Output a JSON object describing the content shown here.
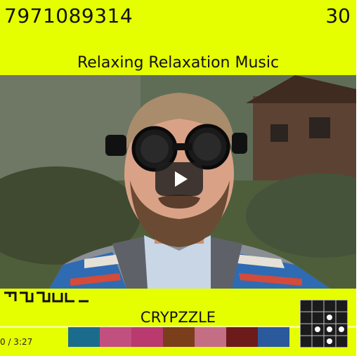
{
  "header": {
    "left_number": "7971089314",
    "right_number": "30"
  },
  "title": "Relaxing Relaxation Music",
  "video": {
    "play_icon": "play-icon",
    "time": "0 / 3:27"
  },
  "band": {
    "name": "CRYPZZLE"
  },
  "colors": {
    "background": "#e6ff00",
    "swatches": [
      "#1b6c8c",
      "#c2507f",
      "#b93a6e",
      "#7b3e1b",
      "#c46e86",
      "#6c1a1a",
      "#2a5a9c"
    ]
  },
  "icons": {
    "logo": "ideogram-logo",
    "grid": "grid-pattern-icon"
  }
}
